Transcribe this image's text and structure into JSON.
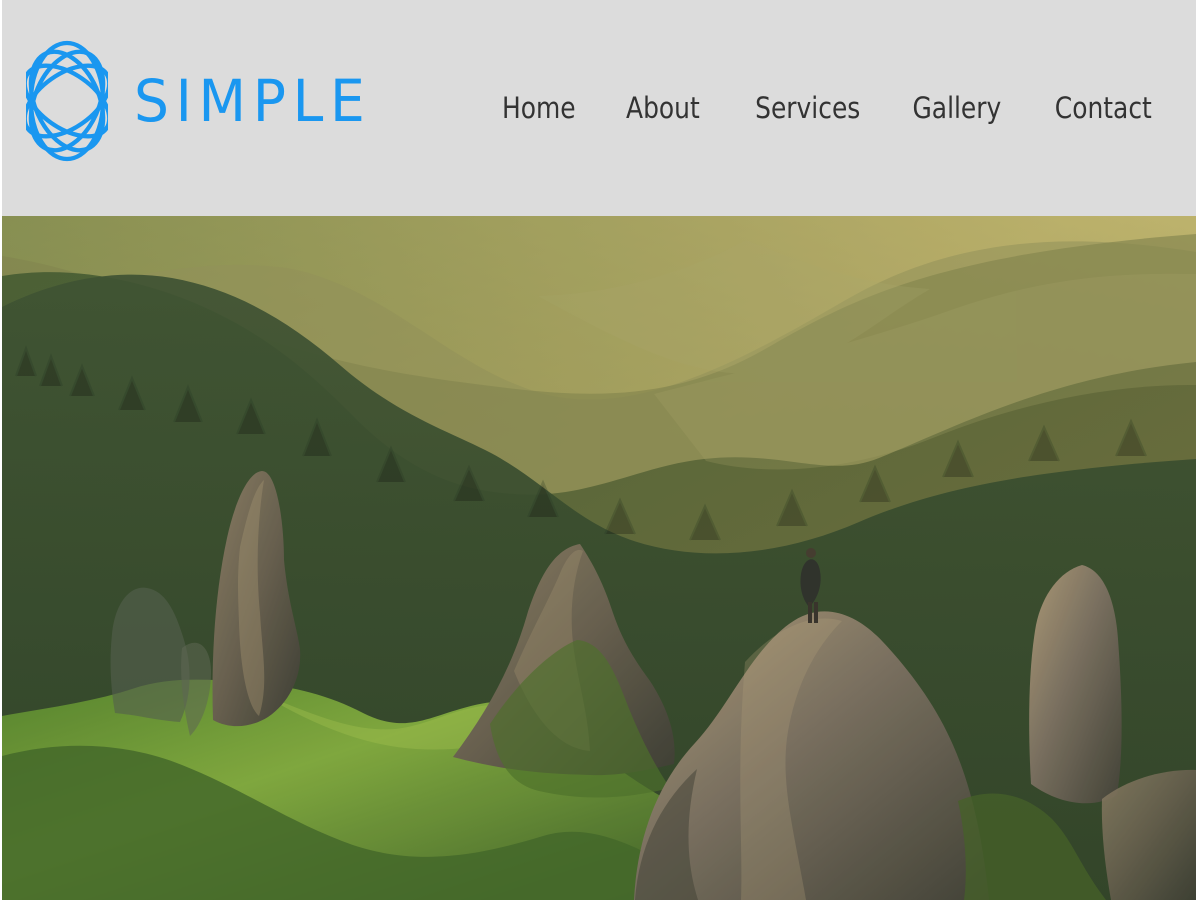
{
  "brand": {
    "name": "SIMPLE",
    "logo_icon": "interlocked-rings-icon",
    "color": "#1a97f0"
  },
  "nav": {
    "items": [
      {
        "label": "Home"
      },
      {
        "label": "About"
      },
      {
        "label": "Services"
      },
      {
        "label": "Gallery"
      },
      {
        "label": "Contact"
      }
    ]
  },
  "hero": {
    "image": "mountain-landscape-photo"
  },
  "colors": {
    "header_bg": "#dcdcdc",
    "nav_text": "#333333"
  }
}
